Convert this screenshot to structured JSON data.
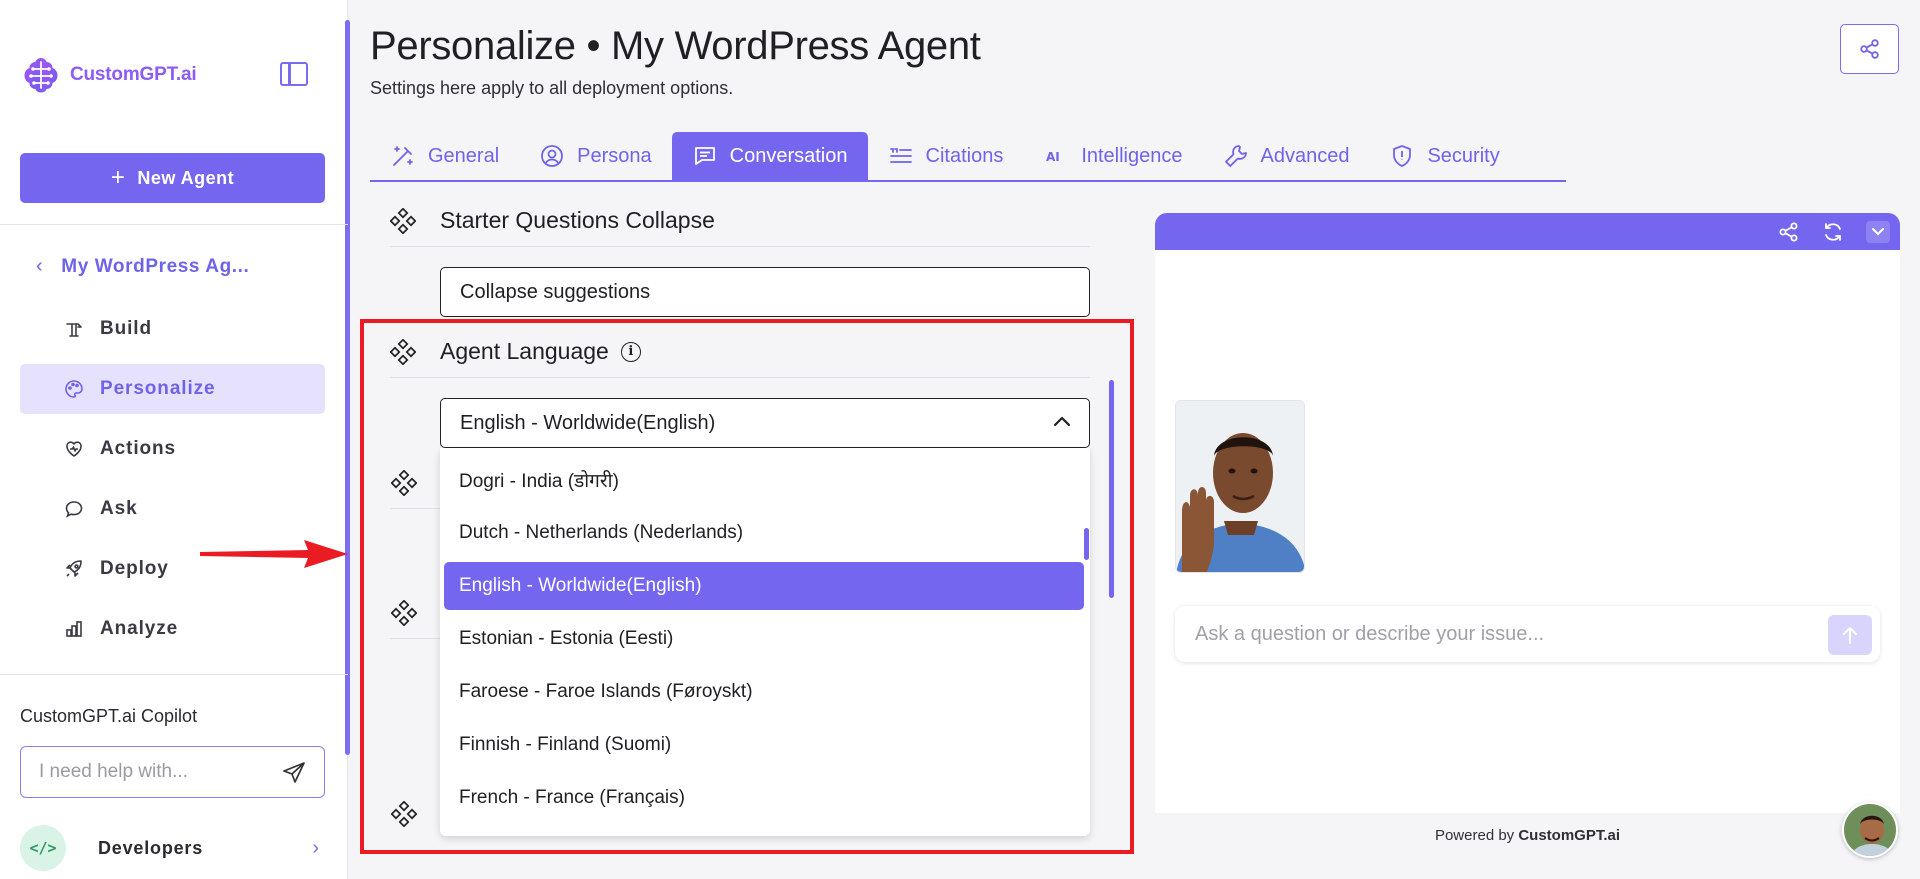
{
  "brand": {
    "name": "CustomGPT.ai",
    "accent": "#7466ee",
    "highlight": "#ea1b23"
  },
  "sidebar": {
    "new_agent_label": "New Agent",
    "agent_name": "My WordPress Ag...",
    "items": [
      {
        "label": "Build",
        "icon": "build-icon"
      },
      {
        "label": "Personalize",
        "icon": "palette-icon",
        "active": true
      },
      {
        "label": "Actions",
        "icon": "actions-icon"
      },
      {
        "label": "Ask",
        "icon": "chat-icon"
      },
      {
        "label": "Deploy",
        "icon": "rocket-icon"
      },
      {
        "label": "Analyze",
        "icon": "bar-chart-icon"
      }
    ],
    "copilot": {
      "label": "CustomGPT.ai Copilot",
      "placeholder": "I need help with..."
    },
    "developers_label": "Developers",
    "developers_icon_text": "</>"
  },
  "header": {
    "title": "Personalize • My WordPress Agent",
    "subtitle": "Settings here apply to all deployment options."
  },
  "tabs": [
    {
      "label": "General",
      "icon": "wand-icon"
    },
    {
      "label": "Persona",
      "icon": "user-circle-icon"
    },
    {
      "label": "Conversation",
      "icon": "message-icon",
      "active": true
    },
    {
      "label": "Citations",
      "icon": "quote-list-icon"
    },
    {
      "label": "Intelligence",
      "icon": "ai-icon"
    },
    {
      "label": "Advanced",
      "icon": "wrench-icon"
    },
    {
      "label": "Security",
      "icon": "shield-icon"
    }
  ],
  "settings": {
    "starter_questions": {
      "label": "Starter Questions Collapse",
      "value": "Collapse suggestions"
    },
    "agent_language": {
      "label": "Agent Language",
      "selected": "English - Worldwide(English)",
      "options": [
        "Dogri - India (डोगरी)",
        "Dutch - Netherlands (Nederlands)",
        "English - Worldwide(English)",
        "Estonian - Estonia (Eesti)",
        "Faroese - Faroe Islands (Føroyskt)",
        "Finnish - Finland (Suomi)",
        "French - France (Français)"
      ]
    }
  },
  "preview": {
    "chat_placeholder": "Ask a question or describe your issue...",
    "powered_prefix": "Powered by ",
    "powered_brand": "CustomGPT.ai"
  }
}
